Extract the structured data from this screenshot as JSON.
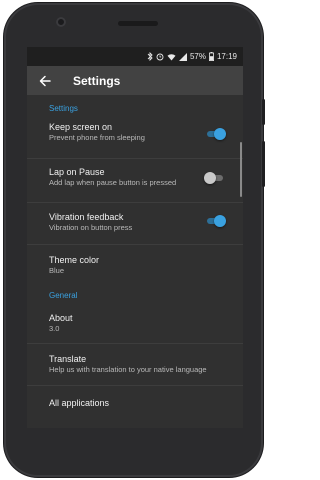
{
  "status_bar": {
    "battery": "57%",
    "time": "17:19",
    "icons": [
      "bluetooth-icon",
      "alarm-icon",
      "wifi-icon",
      "signal-icon",
      "battery-icon"
    ]
  },
  "app_bar": {
    "title": "Settings",
    "back_icon": "arrow-back-icon"
  },
  "sections": [
    {
      "header": "Settings",
      "items": [
        {
          "title": "Keep screen on",
          "subtitle": "Prevent phone from sleeping",
          "switch": true
        },
        {
          "title": "Lap on Pause",
          "subtitle": "Add lap when pause button is pressed",
          "switch": false
        },
        {
          "title": "Vibration feedback",
          "subtitle": "Vibration on button press",
          "switch": true
        },
        {
          "title": "Theme color",
          "subtitle": "Blue"
        }
      ]
    },
    {
      "header": "General",
      "items": [
        {
          "title": "About",
          "subtitle": "3.0"
        },
        {
          "title": "Translate",
          "subtitle": "Help us with translation to your native language"
        },
        {
          "title": "All applications"
        }
      ]
    }
  ],
  "colors": {
    "accent": "#3aa1e0",
    "background": "#303030",
    "app_bar": "#424242",
    "status_bar": "#1f1f1f"
  }
}
